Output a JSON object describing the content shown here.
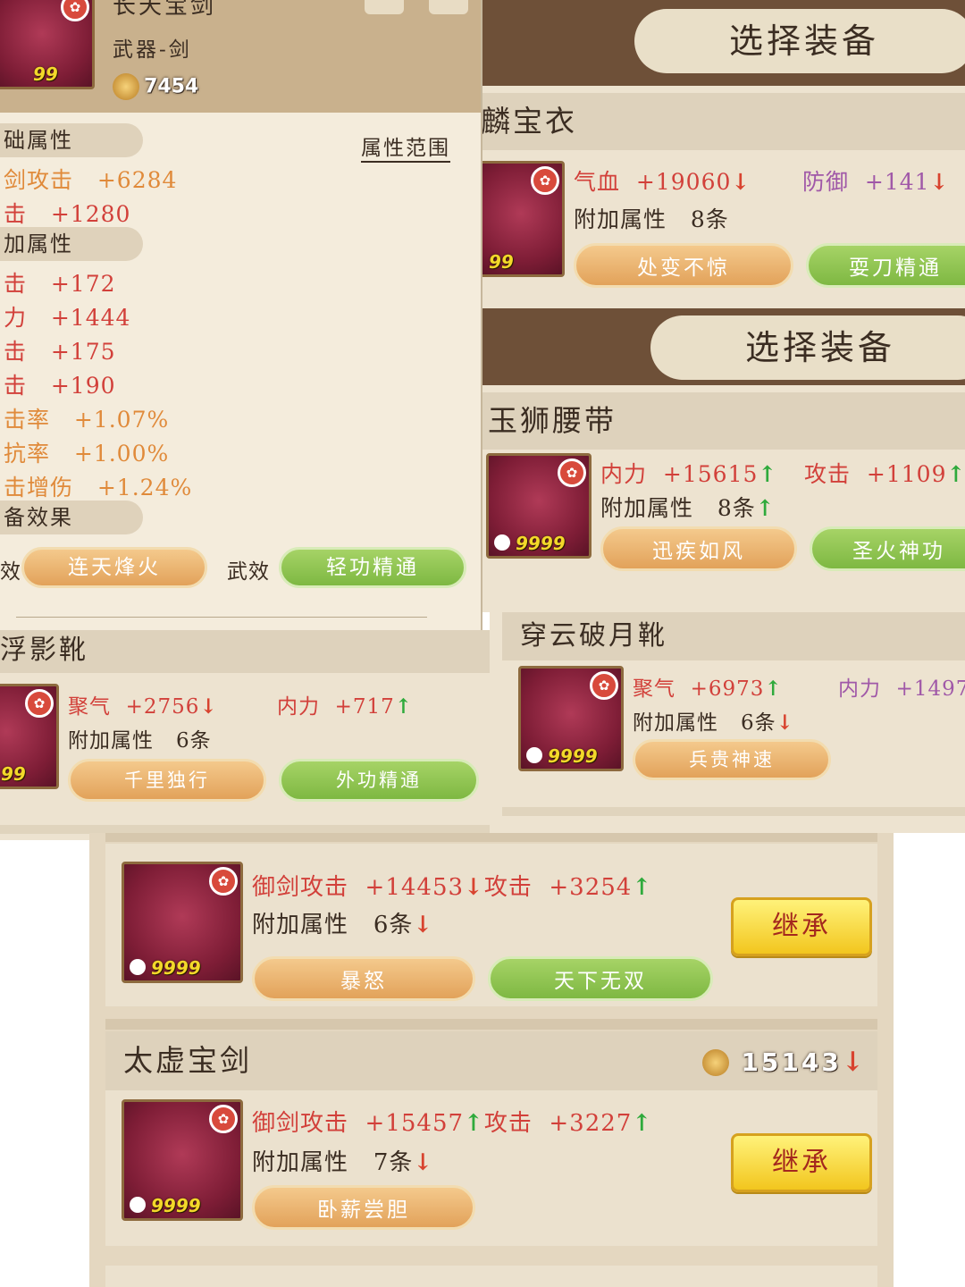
{
  "weapon_panel": {
    "title": "长天宝剑",
    "subtitle": "武器-剑",
    "power": "7454",
    "icon_qty": "99",
    "base_section": "础属性",
    "range_button": "属性范围",
    "base_stats": [
      {
        "label": "剑攻击",
        "value": "+6284"
      },
      {
        "label": "击",
        "value": "+1280"
      }
    ],
    "extra_section": "加属性",
    "extra_stats": [
      {
        "label": "击",
        "value": "+172"
      },
      {
        "label": "力",
        "value": "+1444"
      },
      {
        "label": "击",
        "value": "+175"
      },
      {
        "label": "击",
        "value": "+190"
      },
      {
        "label": "击率",
        "value": "+1.07%"
      },
      {
        "label": "抗率",
        "value": "+1.00%"
      },
      {
        "label": "击增伤",
        "value": "+1.24%"
      }
    ],
    "effect_section": "备效果",
    "effect_label_1": "效",
    "effect_pill_1": "连天烽火",
    "effect_label_2": "武效",
    "effect_pill_2": "轻功精通"
  },
  "select_banner_1": "选择装备",
  "armor_card": {
    "name": "麟宝衣",
    "stat1_label": "气血",
    "stat1_value": "+19060",
    "stat1_dir": "↓",
    "stat2_label": "防御",
    "stat2_value": "+141",
    "stat2_dir": "↓",
    "extra": "附加属性",
    "extra_count": "8条",
    "pill1": "处变不惊",
    "pill2": "耍刀精通",
    "icon_qty": "99"
  },
  "select_banner_2": "选择装备",
  "belt_card": {
    "name": "玉狮腰带",
    "stat1_label": "内力",
    "stat1_value": "+15615",
    "stat1_dir": "↑",
    "stat2_label": "攻击",
    "stat2_value": "+1109",
    "stat2_dir": "↑",
    "extra": "附加属性",
    "extra_count": "8条",
    "extra_dir": "↑",
    "pill1": "迅疾如风",
    "pill2": "圣火神功",
    "icon_qty": "9999"
  },
  "boots_left": {
    "name": "浮影靴",
    "stat1_label": "聚气",
    "stat1_value": "+2756",
    "stat1_dir": "↓",
    "stat2_label": "内力",
    "stat2_value": "+717",
    "stat2_dir": "↑",
    "extra": "附加属性",
    "extra_count": "6条",
    "pill1": "千里独行",
    "pill2": "外功精通",
    "icon_qty": "99"
  },
  "boots_right": {
    "name": "穿云破月靴",
    "stat1_label": "聚气",
    "stat1_value": "+6973",
    "stat1_dir": "↑",
    "stat2_label": "内力",
    "stat2_value": "+1497",
    "stat2_dir": "↓",
    "extra": "附加属性",
    "extra_count": "6条",
    "extra_dir": "↓",
    "pill1": "兵贵神速",
    "icon_qty": "9999"
  },
  "sword_list": {
    "item1": {
      "stat1_label": "御剑攻击",
      "stat1_value": "+14453",
      "stat1_dir": "↓",
      "stat2_label": "攻击",
      "stat2_value": "+3254",
      "stat2_dir": "↑",
      "extra": "附加属性",
      "extra_count": "6条",
      "extra_dir": "↓",
      "pill1": "暴怒",
      "pill2": "天下无双",
      "inherit": "继承",
      "icon_qty": "9999"
    },
    "item2": {
      "name": "太虚宝剑",
      "power": "15143",
      "power_dir": "↓",
      "stat1_label": "御剑攻击",
      "stat1_value": "+15457",
      "stat1_dir": "↑",
      "stat2_label": "攻击",
      "stat2_value": "+3227",
      "stat2_dir": "↑",
      "extra": "附加属性",
      "extra_count": "7条",
      "extra_dir": "↓",
      "pill1": "卧薪尝胆",
      "inherit": "继承",
      "icon_qty": "9999"
    }
  },
  "colors": {
    "brand_brown": "#6e5038",
    "paper": "#ede3d0",
    "stat_red": "#d2403a",
    "up_green": "#2faa3c",
    "down_red": "#d8432f"
  },
  "icons": [
    "sword-icon",
    "robe-icon",
    "belt-icon",
    "boots-icon",
    "lock-icon",
    "rosette-icon",
    "coin-icon",
    "arrow-up-icon",
    "arrow-down-icon"
  ]
}
